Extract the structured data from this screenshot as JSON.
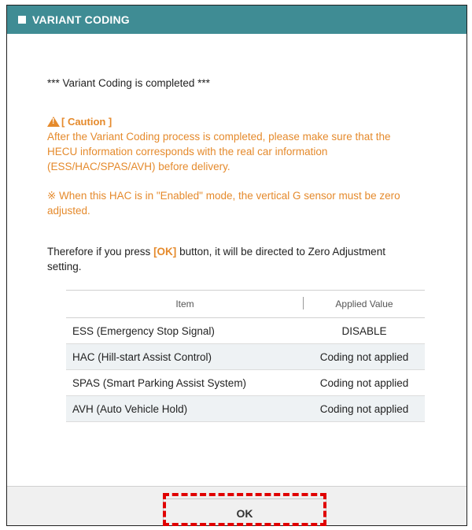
{
  "dialog": {
    "title": "VARIANT CODING"
  },
  "message": {
    "completed": "*** Variant Coding is completed ***",
    "caution_heading": "[ Caution ]",
    "caution_line1": "After the Variant Coding process is completed, please make sure that the",
    "caution_line2": "HECU information corresponds with the real car information",
    "caution_line3": "(ESS/HAC/SPAS/AVH) before delivery.",
    "hac_note_line1": "※ When this HAC is in \"Enabled\" mode, the vertical G sensor must be zero",
    "hac_note_line2": "adjusted.",
    "therefore_prefix": "Therefore if you press ",
    "therefore_ok": "[OK]",
    "therefore_suffix": " button, it will be directed to Zero Adjustment",
    "therefore_line2": "setting."
  },
  "table": {
    "headers": [
      "Item",
      "Applied Value"
    ],
    "rows": [
      {
        "item": "ESS (Emergency Stop Signal)",
        "value": "DISABLE"
      },
      {
        "item": "HAC (Hill-start Assist Control)",
        "value": "Coding not applied"
      },
      {
        "item": "SPAS (Smart Parking Assist System)",
        "value": "Coding not applied"
      },
      {
        "item": "AVH (Auto Vehicle Hold)",
        "value": "Coding not applied"
      }
    ]
  },
  "footer": {
    "ok_label": "OK"
  },
  "colors": {
    "title_bar": "#3f8c94",
    "caution_text": "#e58a2c",
    "highlight": "#e00000"
  }
}
